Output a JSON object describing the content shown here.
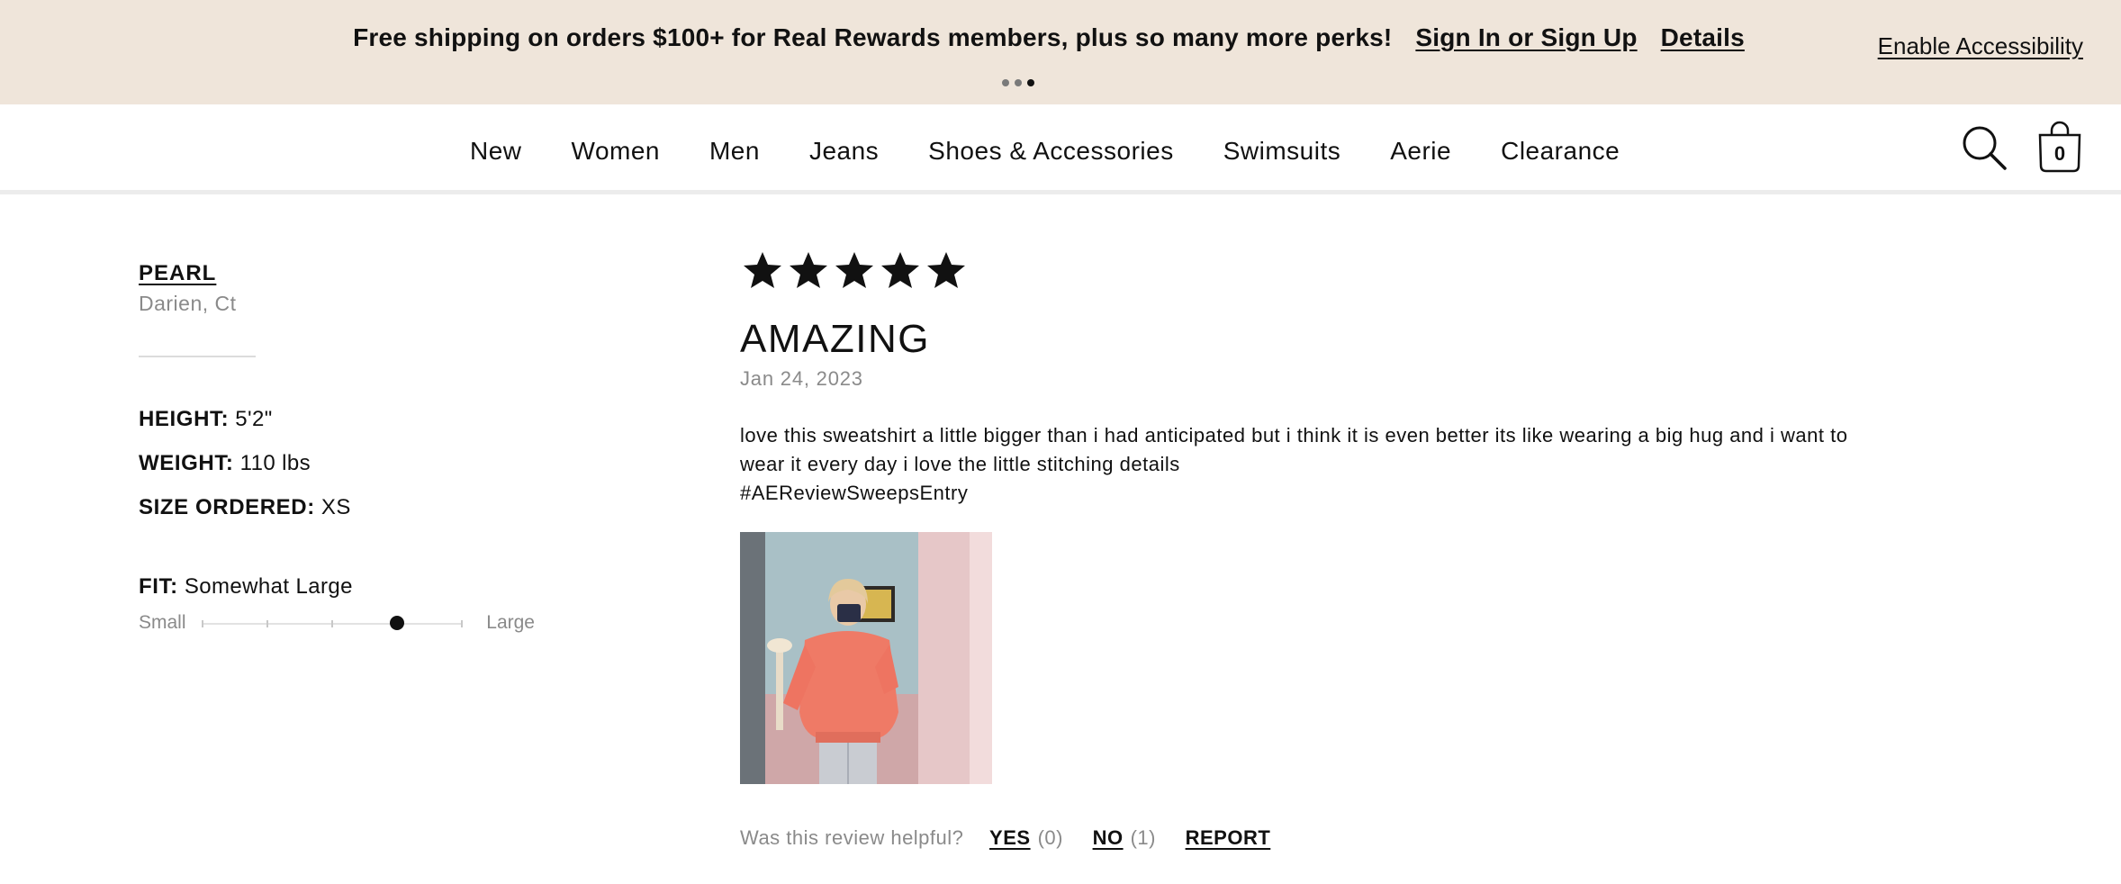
{
  "promo": {
    "message": "Free shipping on orders $100+ for Real Rewards members, plus so many more perks!",
    "sign_in_link": "Sign In or Sign Up",
    "details_link": "Details",
    "slides": 3,
    "active_slide": 3,
    "accessibility_link": "Enable Accessibility"
  },
  "nav": {
    "items": [
      "New",
      "Women",
      "Men",
      "Jeans",
      "Shoes & Accessories",
      "Swimsuits",
      "Aerie",
      "Clearance"
    ],
    "search_icon": "search-icon",
    "bag_icon": "shopping-bag-icon",
    "bag_count": "0"
  },
  "reviewer": {
    "name": "PEARL",
    "location": "Darien, Ct",
    "height_label": "HEIGHT:",
    "height": "5'2\"",
    "weight_label": "WEIGHT:",
    "weight": "110 lbs",
    "size_label": "SIZE ORDERED:",
    "size": "XS",
    "fit_label": "FIT:",
    "fit": "Somewhat Large",
    "fit_scale_min": "Small",
    "fit_scale_max": "Large",
    "fit_scale_steps": 5,
    "fit_level": 4
  },
  "review": {
    "rating": 5,
    "rating_max": 5,
    "star_icon": "star-icon",
    "title": "AMAZING",
    "date": "Jan 24, 2023",
    "body": "love this sweatshirt a little bigger than i had anticipated but i think it is even better its like wearing a big hug and i want to wear it every day i love the little stitching details",
    "hashtag": "#AEReviewSweepsEntry",
    "helpful_prompt": "Was this review helpful?",
    "yes_label": "YES",
    "yes_count": "(0)",
    "no_label": "NO",
    "no_count": "(1)",
    "report_label": "REPORT"
  },
  "colors": {
    "banner_bg": "#efe5da",
    "text": "#111111",
    "muted": "#8a8a8a"
  }
}
